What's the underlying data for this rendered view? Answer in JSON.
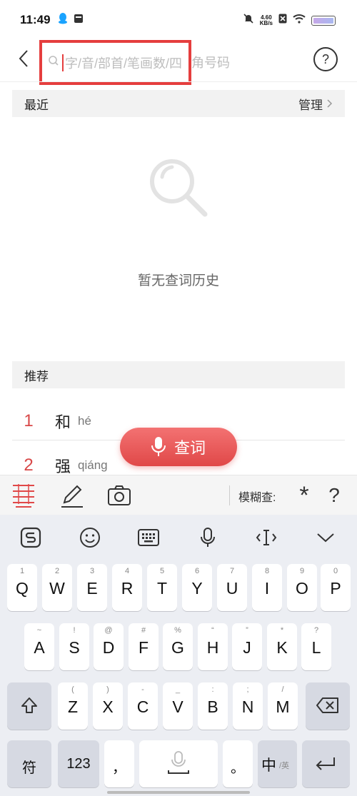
{
  "status": {
    "time": "11:49",
    "net_speed_value": "4.60",
    "net_speed_unit": "KB/s"
  },
  "header": {
    "search_placeholder_visible": "字/音/部首/笔画数/四",
    "search_placeholder_overflow": "角号码",
    "help_label": "?"
  },
  "recent": {
    "title": "最近",
    "manage_label": "管理",
    "empty_text": "暂无查词历史"
  },
  "recommend": {
    "title": "推荐",
    "items": [
      {
        "index": "1",
        "char": "和",
        "pinyin": "hé"
      },
      {
        "index": "2",
        "char": "强",
        "pinyin": "qiáng"
      }
    ]
  },
  "query_button": {
    "label": "查词"
  },
  "tool_bar": {
    "fuzzy_label": "模糊查:",
    "wildcard_symbol": "*",
    "unknown_symbol": "?"
  },
  "keyboard": {
    "row1": [
      {
        "hint": "1",
        "key": "Q"
      },
      {
        "hint": "2",
        "key": "W"
      },
      {
        "hint": "3",
        "key": "E"
      },
      {
        "hint": "4",
        "key": "R"
      },
      {
        "hint": "5",
        "key": "T"
      },
      {
        "hint": "6",
        "key": "Y"
      },
      {
        "hint": "7",
        "key": "U"
      },
      {
        "hint": "8",
        "key": "I"
      },
      {
        "hint": "9",
        "key": "O"
      },
      {
        "hint": "0",
        "key": "P"
      }
    ],
    "row2": [
      {
        "hint": "~",
        "key": "A"
      },
      {
        "hint": "!",
        "key": "S"
      },
      {
        "hint": "@",
        "key": "D"
      },
      {
        "hint": "#",
        "key": "F"
      },
      {
        "hint": "%",
        "key": "G"
      },
      {
        "hint": "“",
        "key": "H"
      },
      {
        "hint": "”",
        "key": "J"
      },
      {
        "hint": "*",
        "key": "K"
      },
      {
        "hint": "?",
        "key": "L"
      }
    ],
    "row3": [
      {
        "hint": "(",
        "key": "Z"
      },
      {
        "hint": ")",
        "key": "X"
      },
      {
        "hint": "-",
        "key": "C"
      },
      {
        "hint": "_",
        "key": "V"
      },
      {
        "hint": ":",
        "key": "B"
      },
      {
        "hint": ";",
        "key": "N"
      },
      {
        "hint": "/",
        "key": "M"
      }
    ],
    "symbol_key": "符",
    "number_key": "123",
    "comma_key": "，",
    "period_key": "。",
    "lang_key_main": "中",
    "lang_key_alt": "/英"
  },
  "colors": {
    "accent": "#e04848",
    "highlight_border": "#e53e3e"
  }
}
